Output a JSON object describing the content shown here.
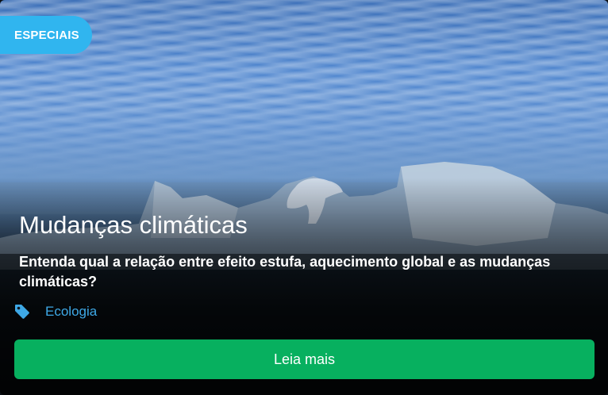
{
  "badge": {
    "label": "ESPECIAIS"
  },
  "article": {
    "title": "Mudanças climáticas",
    "description": "Entenda qual a relação entre efeito estufa, aquecimento global e as mudanças climáticas?",
    "tag": {
      "icon": "tag-icon",
      "label": "Ecologia"
    }
  },
  "cta": {
    "label": "Leia mais"
  },
  "colors": {
    "badge": "#30b5ef",
    "tag_text": "#3ea8e6",
    "button": "#07b05f"
  }
}
